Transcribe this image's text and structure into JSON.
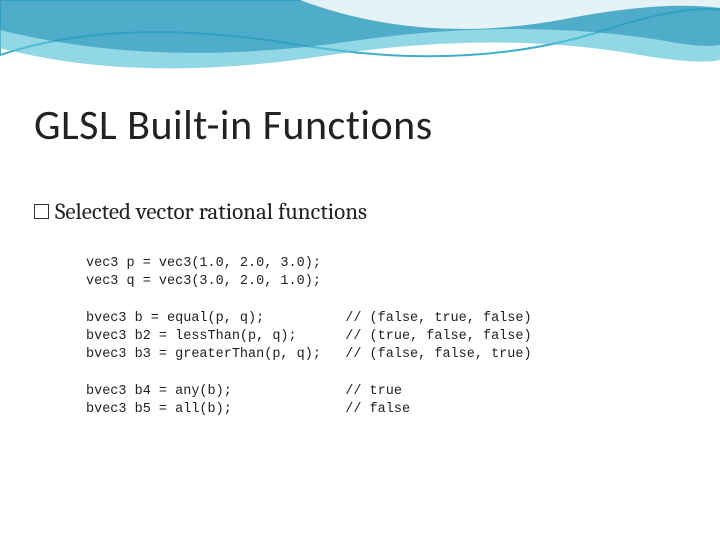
{
  "slide": {
    "title": "GLSL Built-in Functions",
    "subtitle": "Selected vector rational functions"
  },
  "code": {
    "l1": "vec3 p = vec3(1.0, 2.0, 3.0);",
    "l2": "vec3 q = vec3(3.0, 2.0, 1.0);",
    "l3": "",
    "l4": "bvec3 b = equal(p, q);          // (false, true, false)",
    "l5": "bvec3 b2 = lessThan(p, q);      // (true, false, false)",
    "l6": "bvec3 b3 = greaterThan(p, q);   // (false, false, true)",
    "l7": "",
    "l8": "bvec3 b4 = any(b);              // true",
    "l9": "bvec3 b5 = all(b);              // false"
  }
}
